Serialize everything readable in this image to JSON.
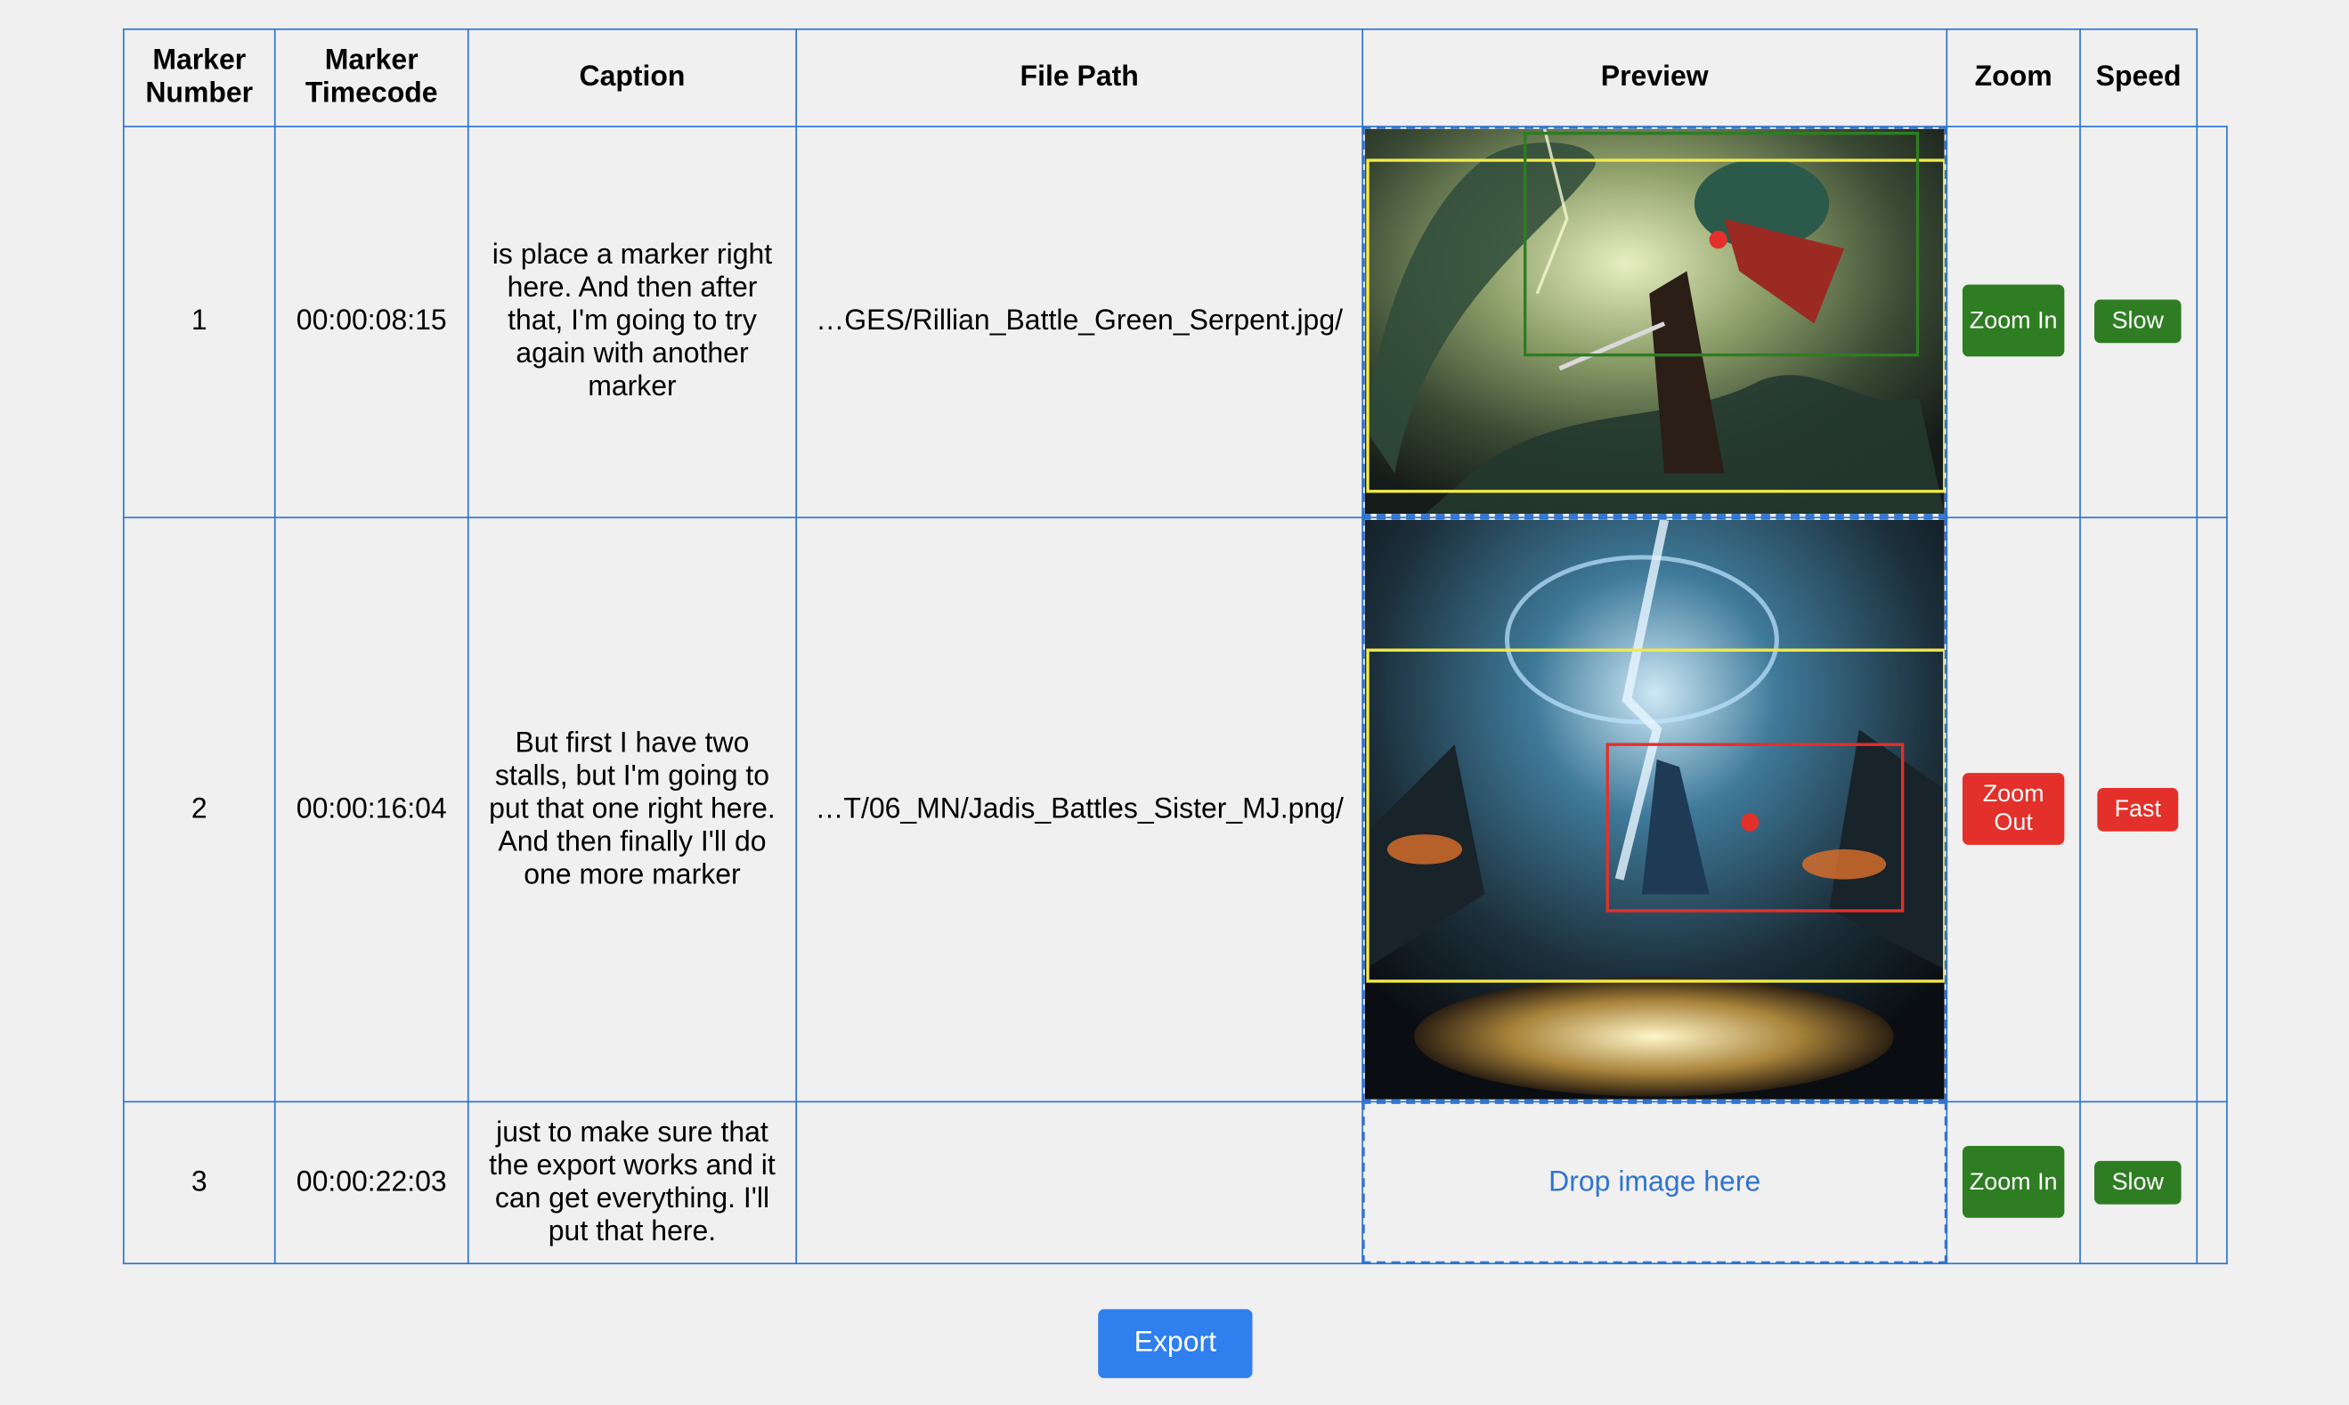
{
  "table": {
    "headers": {
      "marker_number": "Marker Number",
      "marker_timecode": "Marker Timecode",
      "caption": "Caption",
      "file_path": "File Path",
      "preview": "Preview",
      "zoom": "Zoom",
      "speed": "Speed"
    },
    "rows": [
      {
        "number": "1",
        "timecode": "00:00:08:15",
        "caption": "is place a marker right here. And then after that, I'm going to try again with another marker",
        "file_path": "…GES/Rillian_Battle_Green_Serpent.jpg/",
        "preview_icon": "serpent-battle-image",
        "zoom_label": "Zoom In",
        "zoom_color": "#2e7d22",
        "speed_label": "Slow",
        "speed_color": "#2e7d22"
      },
      {
        "number": "2",
        "timecode": "00:00:16:04",
        "caption": "But first I have two stalls, but I'm going to put that one right here. And then finally I'll do one more marker",
        "file_path": "…T/06_MN/Jadis_Battles_Sister_MJ.png/",
        "preview_icon": "sorceress-battle-image",
        "zoom_label": "Zoom Out",
        "zoom_color": "#e3302a",
        "speed_label": "Fast",
        "speed_color": "#e3302a"
      },
      {
        "number": "3",
        "timecode": "00:00:22:03",
        "caption": "just to make sure that the export works and it can get everything. I'll put that here.",
        "file_path": "",
        "drop_text": "Drop image here",
        "zoom_label": "Zoom In",
        "zoom_color": "#2e7d22",
        "speed_label": "Slow",
        "speed_color": "#2e7d22"
      }
    ]
  },
  "export_label": "Export",
  "colors": {
    "border": "#2f74d0",
    "accent": "#2f7fef",
    "frame_yellow": "#f2ea4a",
    "focus_green": "#2e7d22",
    "focus_red": "#e3302a"
  }
}
